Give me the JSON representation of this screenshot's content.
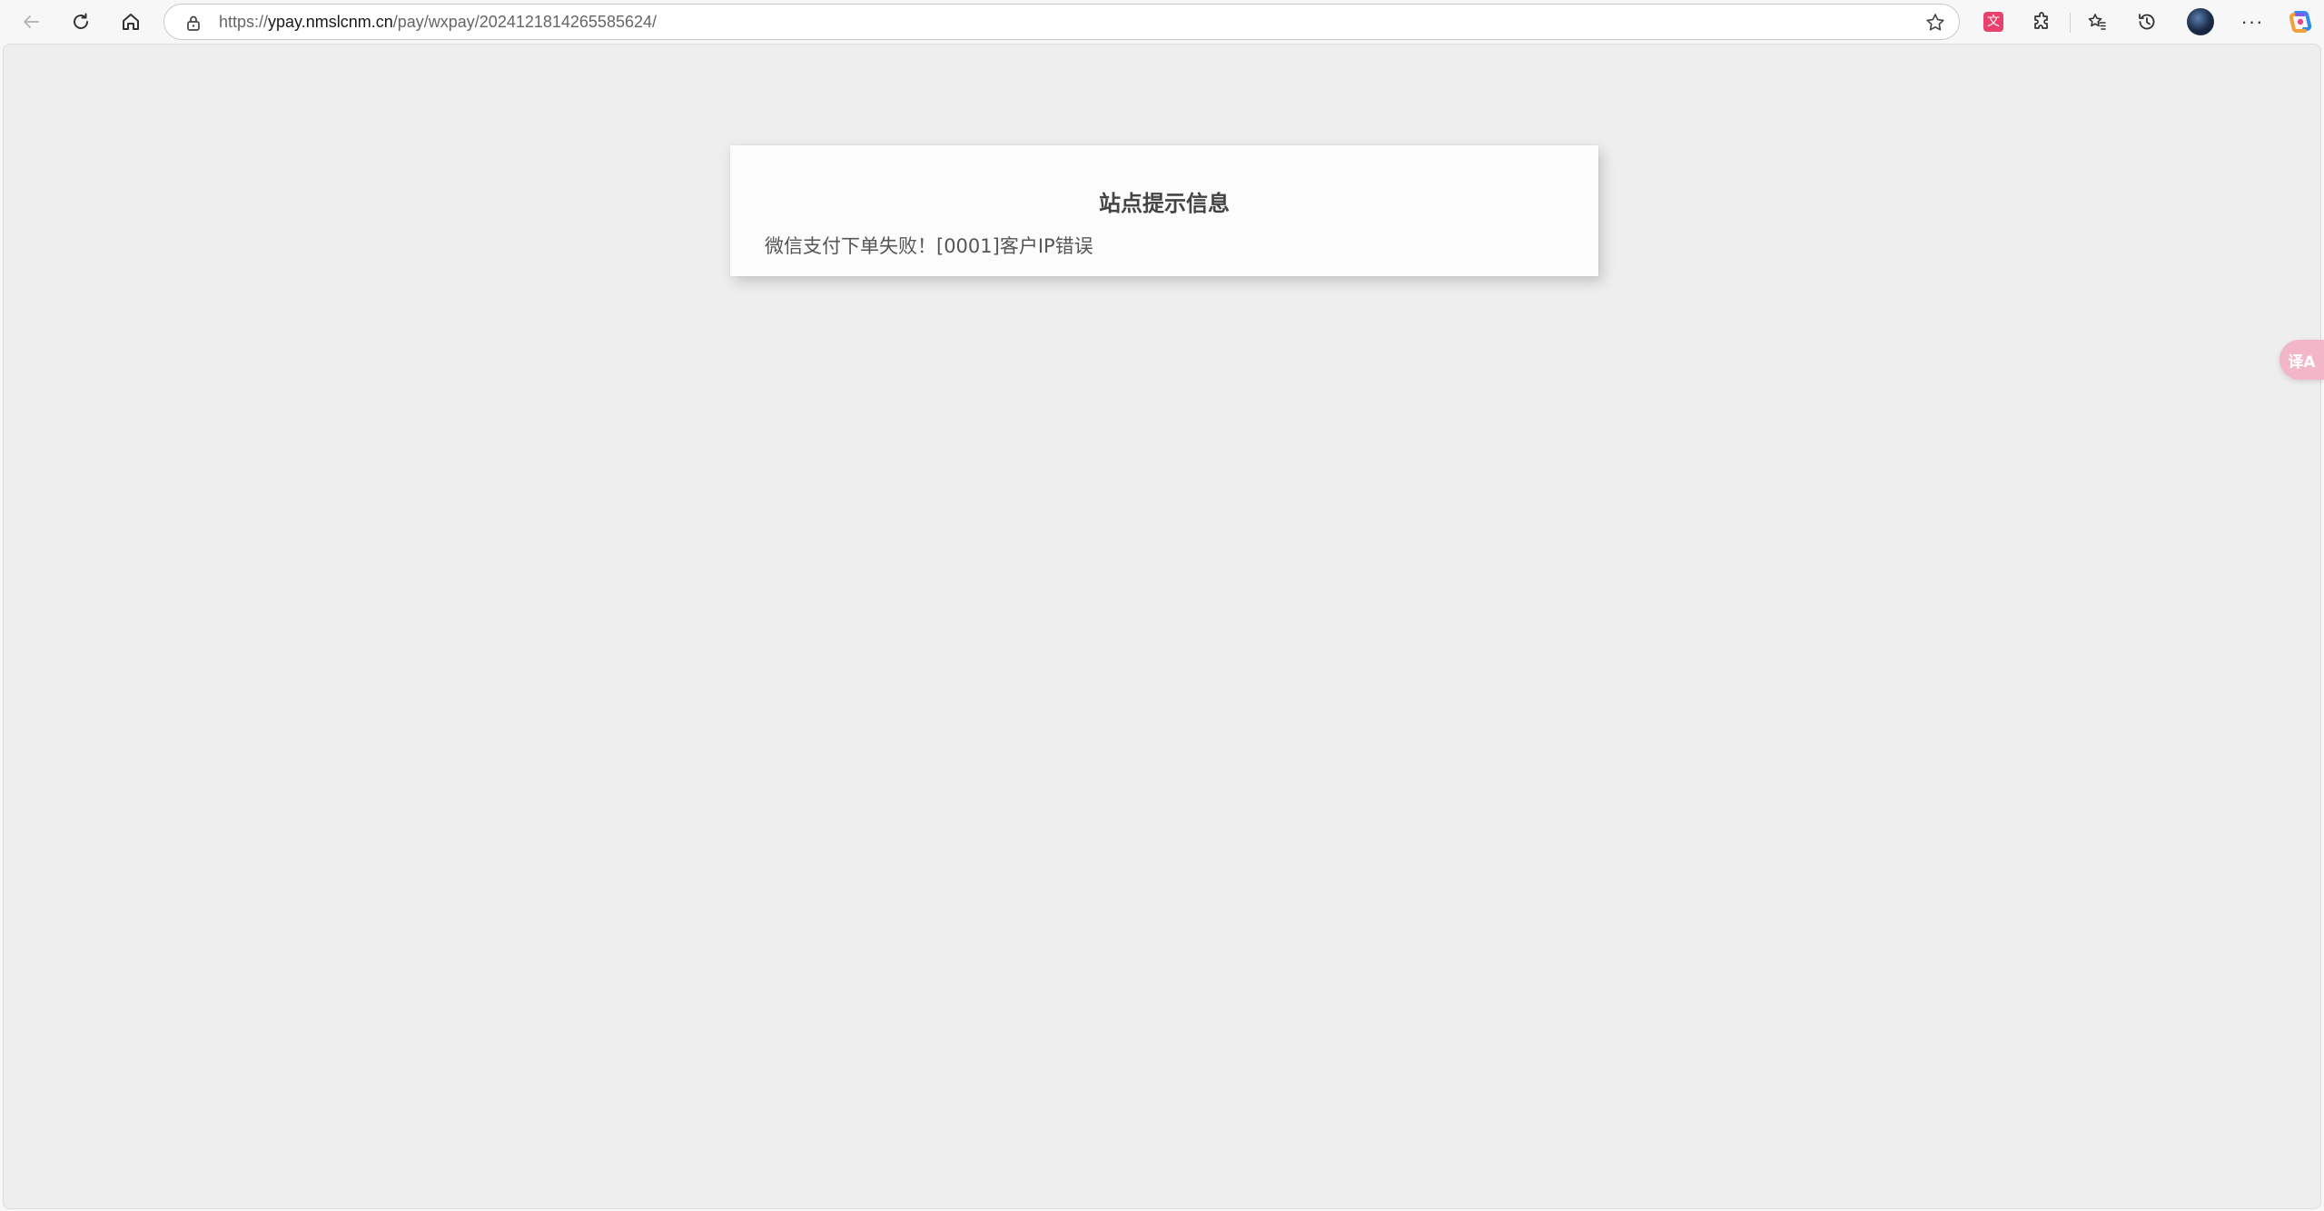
{
  "browser": {
    "url_prefix": "https://",
    "url_host": "ypay.nmslcnm.cn",
    "url_path": "/pay/wxpay/2024121814265585624/",
    "icons": {
      "back": "back-arrow-icon",
      "refresh": "refresh-icon",
      "home": "home-icon",
      "lock": "lock-icon",
      "favorite": "star-icon",
      "translate_ext": "translate-extension-icon",
      "extensions": "puzzle-icon",
      "favorites": "favorites-icon",
      "history": "history-icon",
      "profile": "avatar",
      "more": "more-icon",
      "copilot": "copilot-icon"
    },
    "translate_ext_glyph": "文",
    "more_glyph": "···"
  },
  "page": {
    "title": "站点提示信息",
    "message": "微信支付下单失败！[0001]客户IP错误"
  },
  "floating_translate": {
    "label": "译A"
  },
  "colors": {
    "page_bg": "#eeeeee",
    "card_bg": "#fcfcfc",
    "translate_ext": "#e8416c",
    "floating_translate": "#f3b6c8"
  }
}
